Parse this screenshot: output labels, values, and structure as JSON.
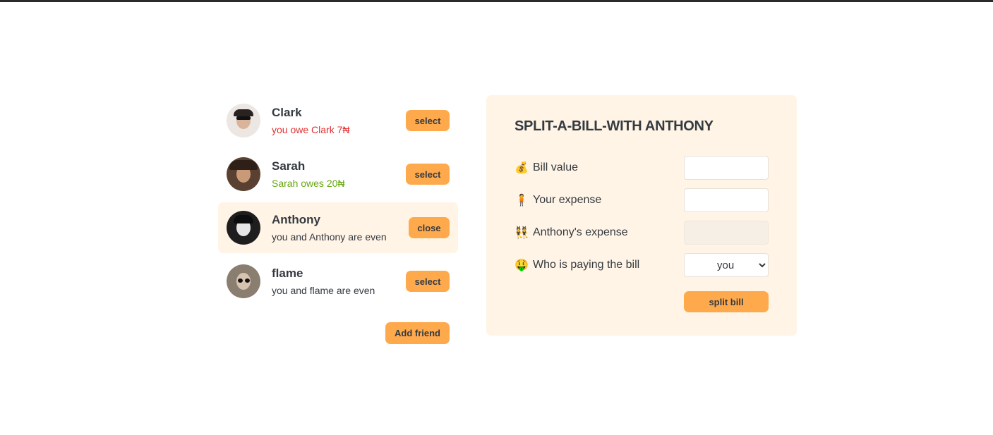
{
  "friends": [
    {
      "name": "Clark",
      "status": "you owe Clark 7₦",
      "status_type": "red",
      "button": "select",
      "selected": false,
      "avatar_color": "#e8e2dc"
    },
    {
      "name": "Sarah",
      "status": "Sarah owes 20₦",
      "status_type": "green",
      "button": "select",
      "selected": false,
      "avatar_color": "#3b2a22"
    },
    {
      "name": "Anthony",
      "status": "you and Anthony are even",
      "status_type": "neutral",
      "button": "close",
      "selected": true,
      "avatar_color": "#1e1e1e"
    },
    {
      "name": "flame",
      "status": "you and flame are even",
      "status_type": "neutral",
      "button": "select",
      "selected": false,
      "avatar_color": "#6b6156"
    }
  ],
  "sidebar": {
    "add_friend_label": "Add friend"
  },
  "form": {
    "title": "Split-a-bill-with Anthony",
    "bill_value": {
      "icon": "money-bag-icon",
      "emoji": "💰",
      "label": "Bill value",
      "value": ""
    },
    "your_expense": {
      "icon": "person-icon",
      "emoji": "🧍",
      "label": "Your expense",
      "value": ""
    },
    "friend_expense": {
      "icon": "people-icon",
      "emoji": "👯",
      "label": "Anthony's expense",
      "value": ""
    },
    "payer": {
      "icon": "money-mouth-face-icon",
      "emoji": "🤑",
      "label": "Who is paying the bill",
      "selected": "you"
    },
    "split_label": "split bill"
  },
  "colors": {
    "accent": "#ffa94d",
    "panel": "#fff4e6",
    "owe_red": "#e03131",
    "owed_green": "#66a80f"
  }
}
